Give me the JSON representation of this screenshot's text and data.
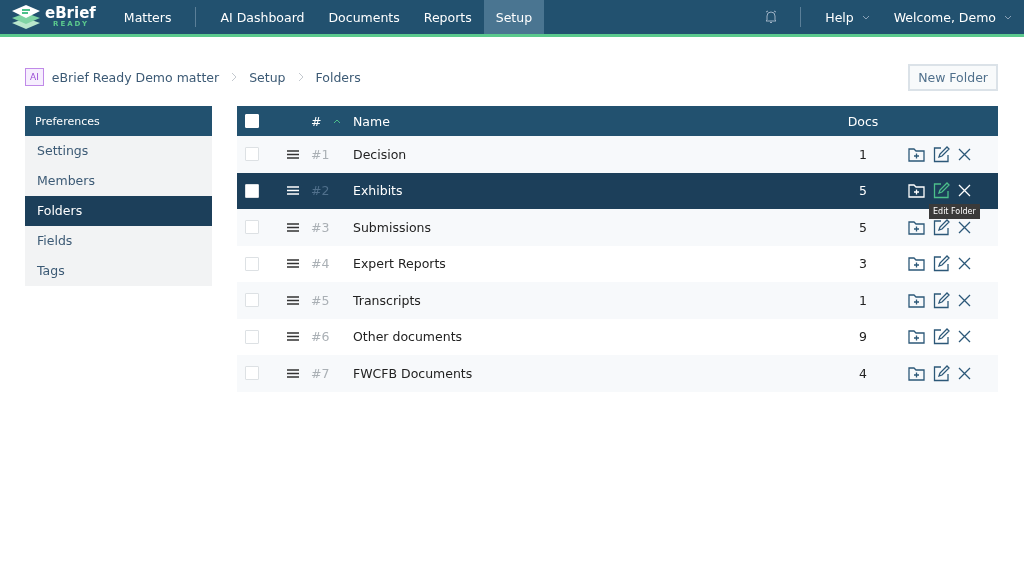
{
  "brand": {
    "name": "eBrief",
    "tagline": "READY"
  },
  "nav": [
    {
      "label": "Matters",
      "selected": false
    },
    {
      "label": "AI Dashboard",
      "selected": false
    },
    {
      "label": "Documents",
      "selected": false
    },
    {
      "label": "Reports",
      "selected": false
    },
    {
      "label": "Setup",
      "selected": true
    }
  ],
  "user_menu": [
    {
      "label": "Help"
    },
    {
      "label": "Welcome, Demo"
    }
  ],
  "breadcrumb": {
    "badge": "AI",
    "items": [
      "eBrief Ready Demo matter",
      "Setup",
      "Folders"
    ]
  },
  "new_folder_button": "New Folder",
  "sidebar": {
    "title": "Preferences",
    "items": [
      {
        "label": "Settings",
        "selected": false
      },
      {
        "label": "Members",
        "selected": false
      },
      {
        "label": "Folders",
        "selected": true
      },
      {
        "label": "Fields",
        "selected": false
      },
      {
        "label": "Tags",
        "selected": false
      }
    ]
  },
  "table": {
    "columns": [
      "#",
      "Name",
      "Docs"
    ],
    "all_checked": false,
    "rows": [
      {
        "number": "#1",
        "name": "Decision",
        "docs": "1",
        "checked": false,
        "selected": false
      },
      {
        "number": "#2",
        "name": "Exhibits",
        "docs": "5",
        "checked": false,
        "selected": true,
        "tooltip": "Edit Folder"
      },
      {
        "number": "#3",
        "name": "Submissions",
        "docs": "5",
        "checked": false,
        "selected": false
      },
      {
        "number": "#4",
        "name": "Expert Reports",
        "docs": "3",
        "checked": false,
        "selected": false
      },
      {
        "number": "#5",
        "name": "Transcripts",
        "docs": "1",
        "checked": false,
        "selected": false
      },
      {
        "number": "#6",
        "name": "Other documents",
        "docs": "9",
        "checked": false,
        "selected": false
      },
      {
        "number": "#7",
        "name": "FWCFB Documents",
        "docs": "4",
        "checked": false,
        "selected": false
      }
    ]
  }
}
